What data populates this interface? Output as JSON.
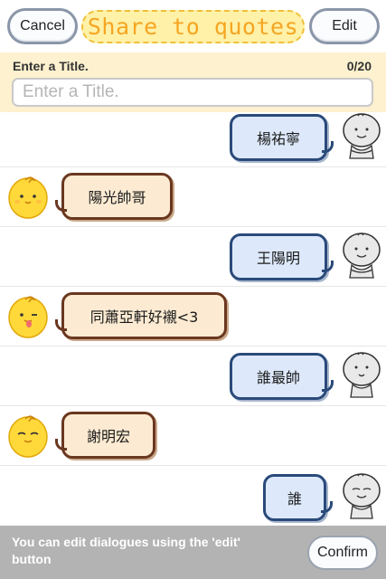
{
  "header": {
    "cancel_label": "Cancel",
    "title": "Share to quotes",
    "edit_label": "Edit"
  },
  "title_entry": {
    "label": "Enter a Title.",
    "counter": "0/20",
    "placeholder": "Enter a Title.",
    "value": ""
  },
  "messages": [
    {
      "side": "right",
      "text": "楊祐寧",
      "avatar": "grey-doodle-avatar-icon"
    },
    {
      "side": "left",
      "text": "陽光帥哥",
      "avatar": "yellow-chick-avatar-icon"
    },
    {
      "side": "right",
      "text": "王陽明",
      "avatar": "grey-doodle-avatar-icon"
    },
    {
      "side": "left",
      "text": "同蕭亞軒好襯<3",
      "avatar": "yellow-chick-tongue-avatar-icon"
    },
    {
      "side": "right",
      "text": "誰最帥",
      "avatar": "grey-doodle-avatar-icon"
    },
    {
      "side": "left",
      "text": "謝明宏",
      "avatar": "yellow-chick-avatar-icon"
    },
    {
      "side": "right",
      "text": "誰",
      "avatar": "grey-doodle-avatar-icon"
    }
  ],
  "footer": {
    "hint": "You can edit dialogues using the 'edit' button",
    "confirm_label": "Confirm"
  },
  "colors": {
    "title_text": "#f5a623",
    "title_badge_bg": "#fff1a8",
    "title_band_bg": "#fdf1cf",
    "right_bubble_bg": "#dde9fb",
    "right_bubble_border": "#2a4a7a",
    "left_bubble_bg": "#fcebd2",
    "left_bubble_border": "#6a3720",
    "footer_bg": "#b3b3b3"
  }
}
